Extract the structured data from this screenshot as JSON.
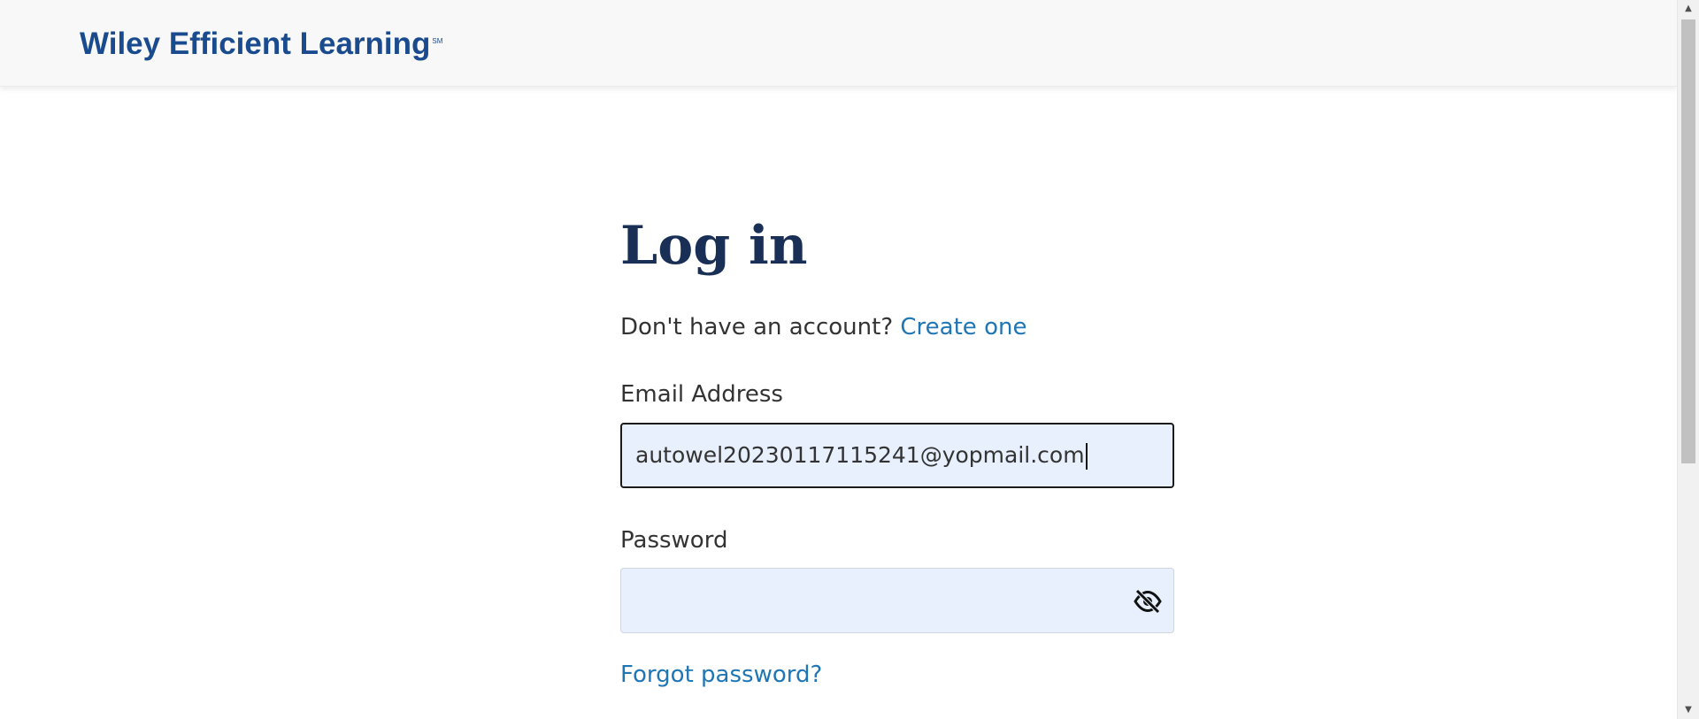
{
  "header": {
    "logo_text": "Wiley Efficient Learning",
    "logo_mark": "SM"
  },
  "login": {
    "title": "Log in",
    "no_account_text": "Don't have an account?",
    "create_link": "Create one",
    "email_label": "Email Address",
    "email_value": "autowel20230117115241@yopmail.com",
    "password_label": "Password",
    "password_value": "",
    "password_toggle_icon": "eye-slash-icon",
    "forgot_link": "Forgot password?"
  },
  "colors": {
    "brand": "#1a4b8e",
    "title": "#1a2f55",
    "link": "#1f76b5",
    "input_bg": "#e8f0fe"
  }
}
